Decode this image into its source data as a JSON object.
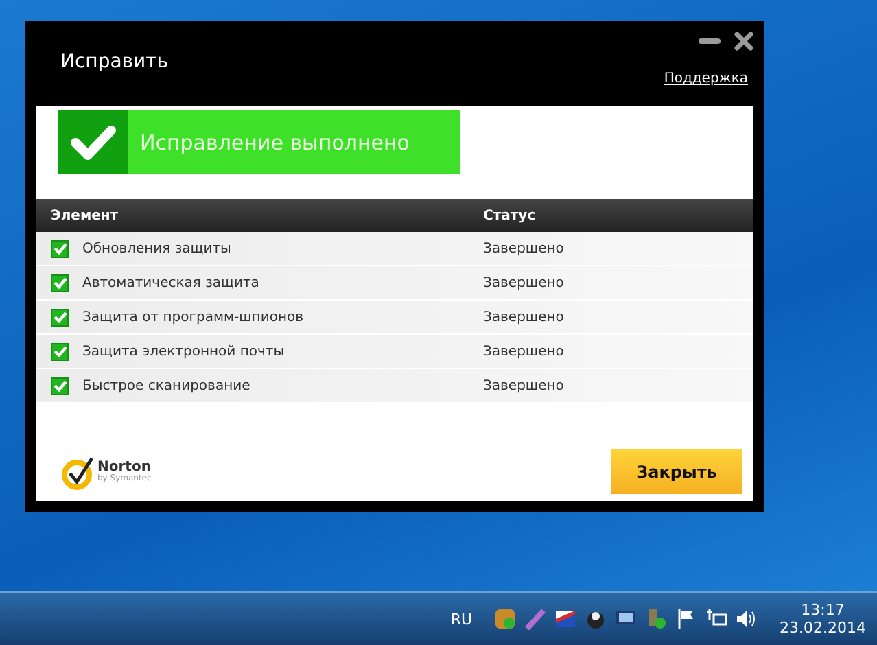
{
  "window": {
    "title": "Исправить",
    "support_link": "Поддержка"
  },
  "banner": {
    "text": "Исправление выполнено"
  },
  "table": {
    "columns": [
      "Элемент",
      "Статус"
    ],
    "rows": [
      {
        "name": "Обновления защиты",
        "status": "Завершено",
        "checked": true
      },
      {
        "name": "Автоматическая защита",
        "status": "Завершено",
        "checked": true
      },
      {
        "name": "Защита от программ-шпионов",
        "status": "Завершено",
        "checked": true
      },
      {
        "name": "Защита электронной почты",
        "status": "Завершено",
        "checked": true
      },
      {
        "name": "Быстрое сканирование",
        "status": "Завершено",
        "checked": true
      }
    ]
  },
  "logo": {
    "name": "Norton",
    "tagline": "by Symantec"
  },
  "close_button": "Закрыть",
  "taskbar": {
    "language": "RU",
    "time": "13:17",
    "date": "23.02.2014"
  }
}
